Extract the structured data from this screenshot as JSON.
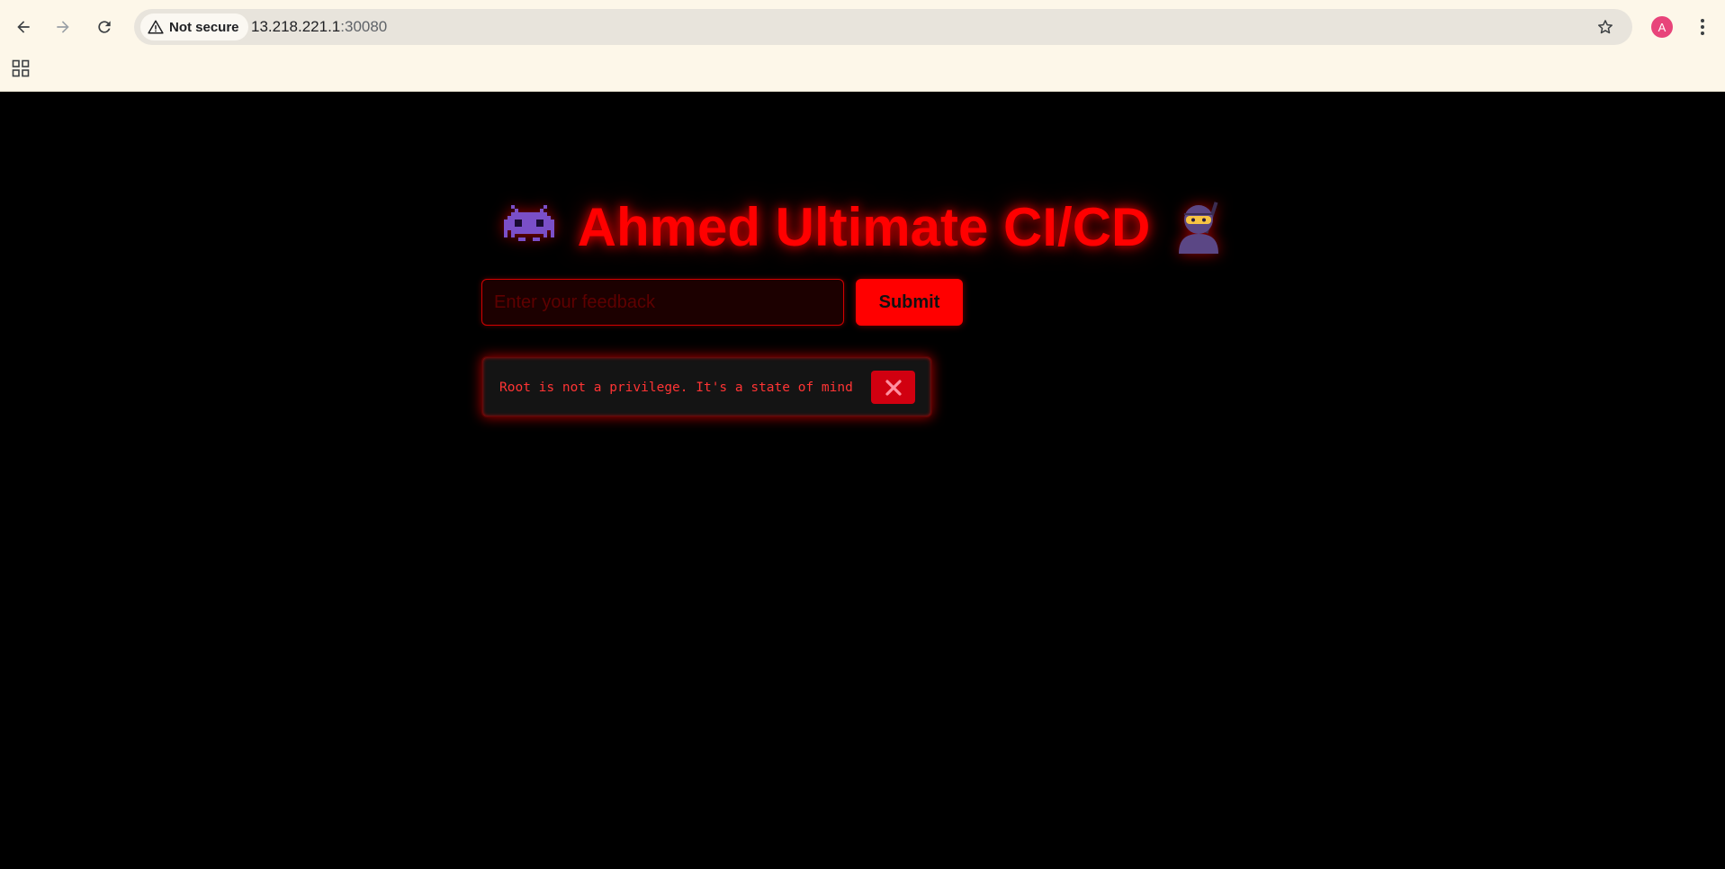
{
  "browser": {
    "security_label": "Not secure",
    "url_host": "13.218.221.1",
    "url_port": ":30080",
    "avatar_initial": "A",
    "icons": {
      "back": "arrow-left-icon",
      "forward": "arrow-right-icon",
      "reload": "reload-icon",
      "security": "warning-triangle-icon",
      "bookmark": "star-icon",
      "menu": "kebab-menu-icon",
      "apps": "apps-grid-icon"
    }
  },
  "page": {
    "title": "Ahmed Ultimate CI/CD",
    "title_emoji_left": "alien-monster-icon",
    "title_emoji_right": "ninja-icon",
    "accent_color": "#ff0000",
    "background_color": "#000000",
    "feedback": {
      "placeholder": "Enter your feedback",
      "value": "",
      "submit_label": "Submit"
    },
    "message": {
      "text": "Root is not a privilege. It's a state of mind",
      "close_icon": "close-icon"
    }
  }
}
